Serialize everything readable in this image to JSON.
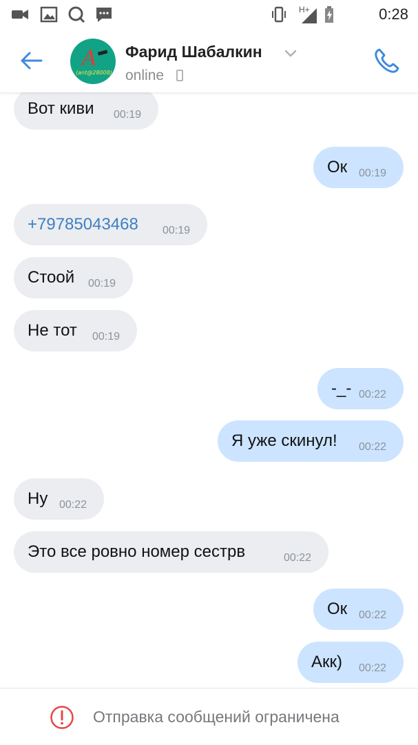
{
  "status_bar": {
    "time": "0:28",
    "network": "H+",
    "icons": [
      "video-camera-icon",
      "gallery-icon",
      "q-app-icon",
      "chat-app-icon",
      "vibrate-icon",
      "signal-icon",
      "battery-icon"
    ]
  },
  "header": {
    "name": "Фарид Шабалкин",
    "status": "online",
    "avatar_letter": "A",
    "avatar_caption": "(ant@28008)"
  },
  "messages": [
    {
      "dir": "in",
      "text": "Вот киви",
      "time": "00:19"
    },
    {
      "dir": "out",
      "text": "Ок",
      "time": "00:19"
    },
    {
      "dir": "in",
      "text": "+79785043468",
      "time": "00:19",
      "link": true
    },
    {
      "dir": "in",
      "text": "Стоой",
      "time": "00:19"
    },
    {
      "dir": "in",
      "text": "Не тот",
      "time": "00:19"
    },
    {
      "dir": "out",
      "text": "-_-",
      "time": "00:22"
    },
    {
      "dir": "out",
      "text": "Я уже скинул!",
      "time": "00:22"
    },
    {
      "dir": "in",
      "text": "Ну",
      "time": "00:22"
    },
    {
      "dir": "in",
      "text": "Это все ровно номер сестрв",
      "time": "00:22"
    },
    {
      "dir": "out",
      "text": "Ок",
      "time": "00:22"
    },
    {
      "dir": "out",
      "text": "Акк)",
      "time": "00:22"
    }
  ],
  "footer": {
    "text": "Отправка сообщений ограничена"
  },
  "colors": {
    "accent": "#3f8ae0",
    "incoming_bubble": "#ebedf0",
    "outgoing_bubble": "#cce4ff",
    "warning": "#e64646",
    "avatar_bg": "#12a386"
  }
}
